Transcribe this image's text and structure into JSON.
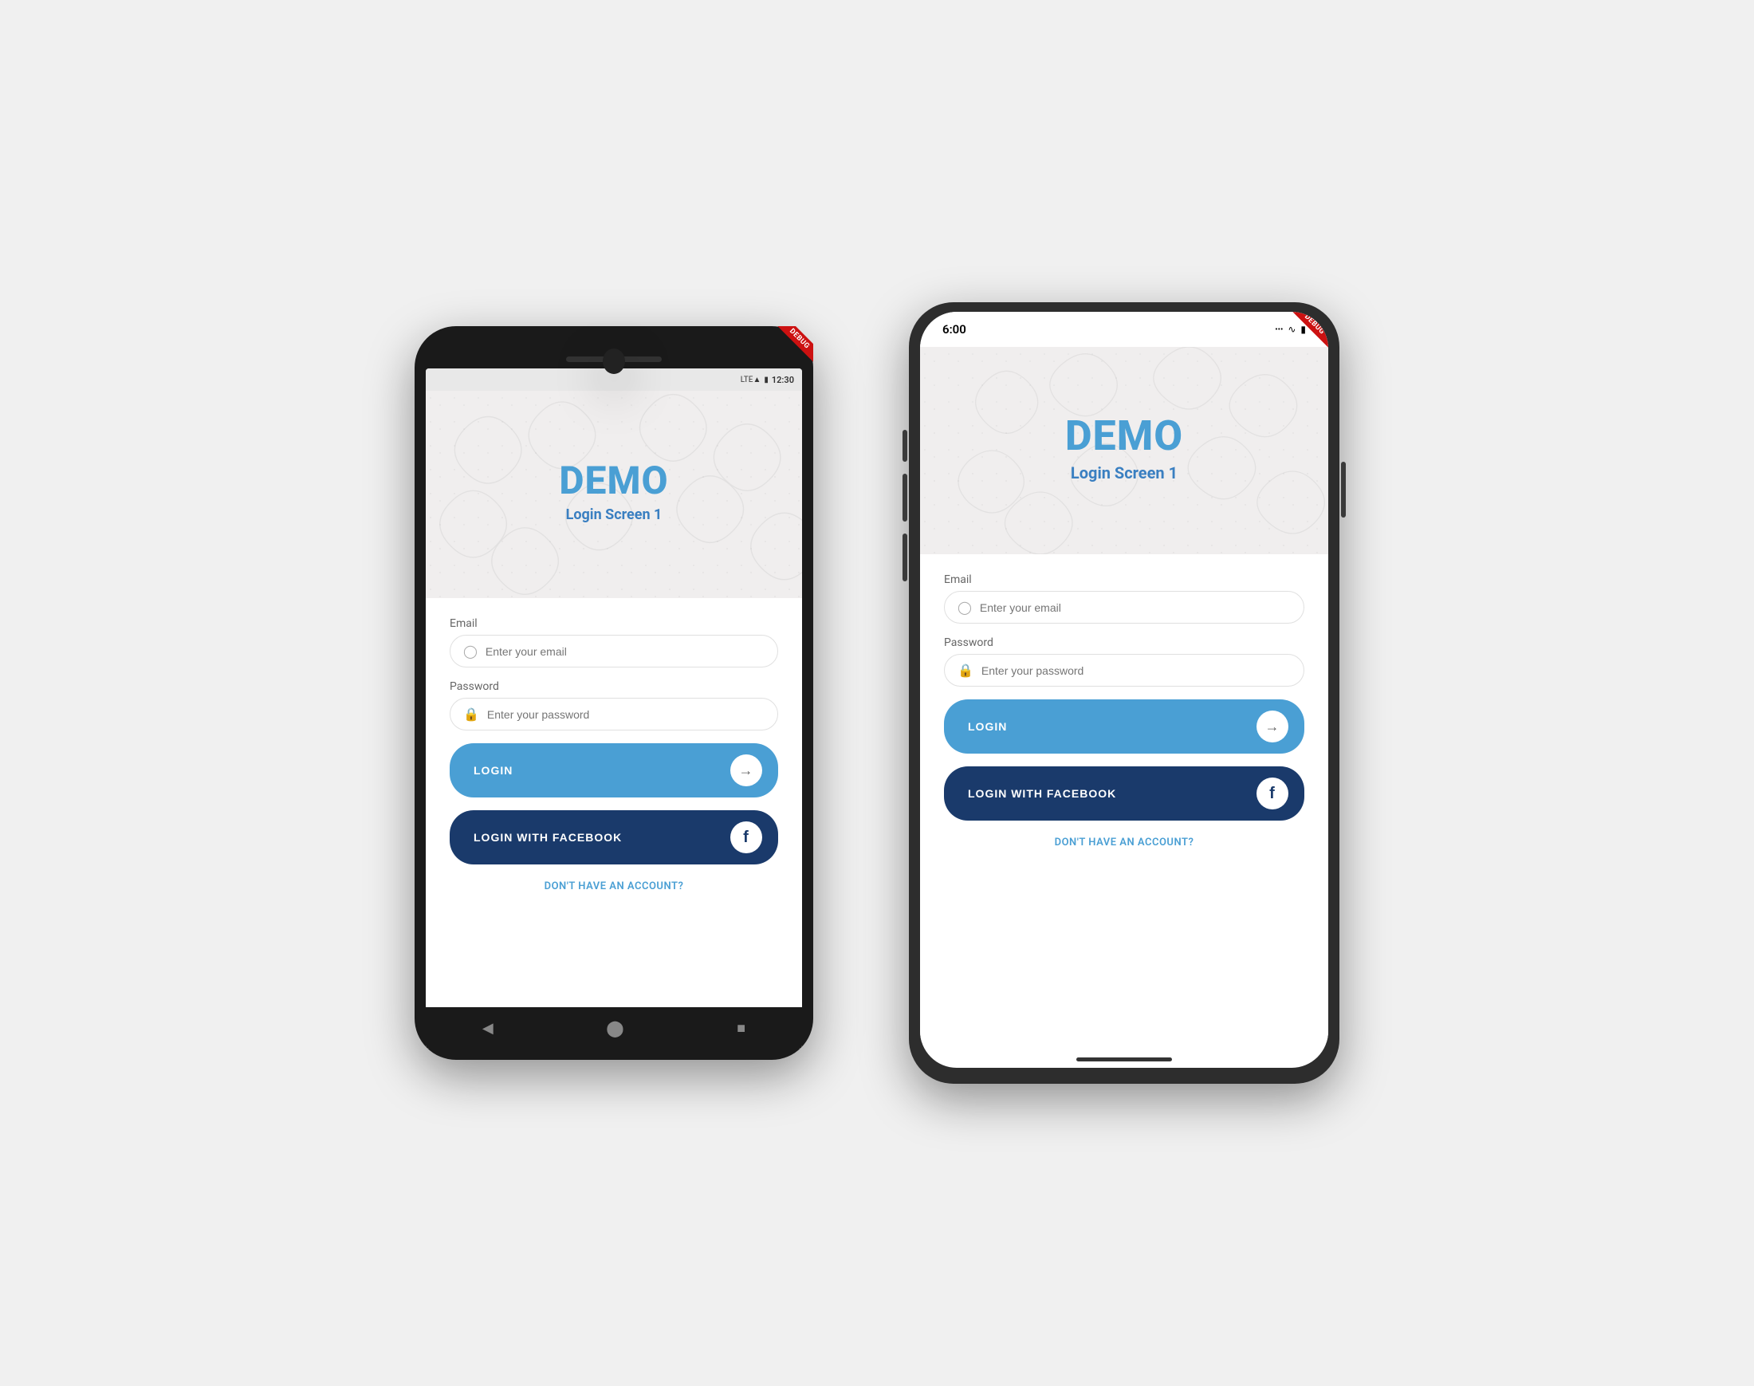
{
  "android": {
    "status": {
      "signal": "LTE",
      "battery": "🔋",
      "time": "12:30"
    },
    "hero": {
      "title": "DEMO",
      "subtitle": "Login Screen 1"
    },
    "form": {
      "email_label": "Email",
      "email_placeholder": "Enter your email",
      "password_label": "Password",
      "password_placeholder": "Enter your password",
      "login_button": "LOGIN",
      "facebook_button": "LOGIN WITH FACEBOOK",
      "signup_link": "DON'T HAVE AN ACCOUNT?"
    }
  },
  "ios": {
    "status": {
      "time": "6:00",
      "wifi": "wifi",
      "battery": "battery"
    },
    "hero": {
      "title": "DEMO",
      "subtitle": "Login Screen 1"
    },
    "form": {
      "email_label": "Email",
      "email_placeholder": "Enter your email",
      "password_label": "Password",
      "password_placeholder": "Enter your password",
      "login_button": "LOGIN",
      "facebook_button": "LOGIN WITH FACEBOOK",
      "signup_link": "DON'T HAVE AN ACCOUNT?"
    }
  },
  "colors": {
    "primary_blue": "#4a9fd4",
    "dark_blue": "#1a3a6b",
    "hero_bg": "#f0eeee",
    "text_gray": "#666",
    "debug_red": "#cc1111"
  },
  "icons": {
    "user": "👤",
    "lock": "🔒",
    "arrow_right": "→",
    "facebook_f": "f"
  }
}
